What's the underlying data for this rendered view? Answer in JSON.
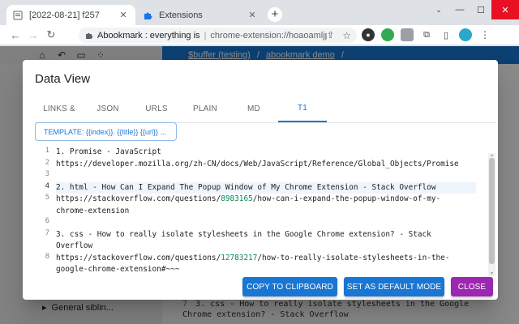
{
  "tabs": [
    {
      "title": "[2022-08-21] f257",
      "active": true
    },
    {
      "title": "Extensions",
      "active": false
    }
  ],
  "new_tab_label": "+",
  "window_controls": {
    "minimize": "—",
    "restore": "⌄",
    "maximize": "☐",
    "close": "✕"
  },
  "omnibox": {
    "site_label": "Abookmark : everything is",
    "url": "chrome-extension://hoaoamljp..."
  },
  "page": {
    "breadcrumb": [
      "$buffer (testing)",
      "abookmark demo"
    ],
    "sidebar_item": "General siblin...",
    "preview_line_number": "7",
    "preview_text": "3. css - How to really isolate stylesheets in the Google\nChrome extension? - Stack Overflow"
  },
  "dialog": {
    "title": "Data View",
    "tabs": [
      "LINKS &",
      "JSON",
      "URLS",
      "PLAIN",
      "MD",
      "T1"
    ],
    "active_tab": "T1",
    "template_label": "TEMPLATE: {{index}}. {{title}} {{url}} ...",
    "gutter": [
      {
        "n": "1",
        "row": 0
      },
      {
        "n": "2",
        "row": 1
      },
      {
        "n": "3",
        "row": 2
      },
      {
        "n": "4",
        "row": 3
      },
      {
        "n": "5",
        "row": 4
      },
      {
        "n": "6",
        "row": 6
      },
      {
        "n": "7",
        "row": 7
      },
      {
        "n": "8",
        "row": 9
      }
    ],
    "lines": [
      "1. Promise - JavaScript",
      "https://developer.mozilla.org/zh-CN/docs/Web/JavaScript/Reference/Global_Objects/Promise",
      "",
      "2. html - How Can I Expand The Popup Window of My Chrome Extension - Stack Overflow",
      "https://stackoverflow.com/questions/8983165/how-can-i-expand-the-popup-window-of-my-",
      "chrome-extension",
      "",
      "3. css - How to really isolate stylesheets in the Google Chrome extension? - Stack",
      "Overflow",
      "https://stackoverflow.com/questions/12783217/how-to-really-isolate-stylesheets-in-the-",
      "google-chrome-extension#~~~"
    ],
    "highlight_row": 3,
    "buttons": {
      "copy": "COPY TO CLIPBOARD",
      "default": "SET AS DEFAULT MODE",
      "close": "CLOSE"
    }
  },
  "colors": {
    "primary": "#1976d2",
    "secondary": "#9c27b0",
    "number": "#09885a"
  }
}
